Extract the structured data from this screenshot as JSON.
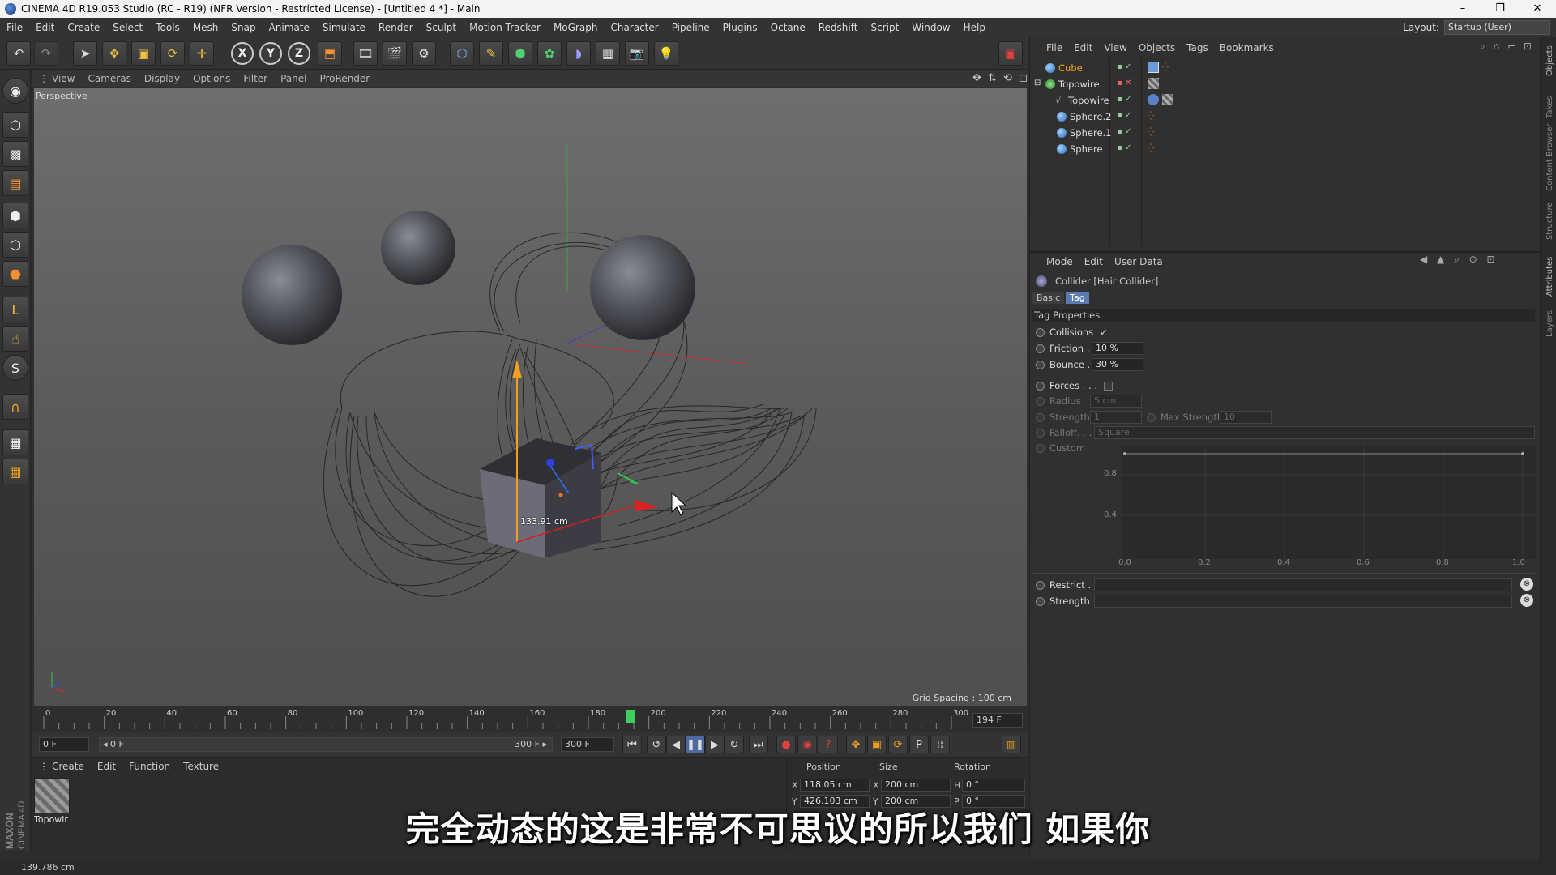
{
  "window": {
    "title": "CINEMA 4D R19.053 Studio (RC - R19) (NFR Version - Restricted License) - [Untitled 4 *] - Main",
    "controls": [
      "–",
      "❐",
      "✕"
    ]
  },
  "menubar": {
    "items": [
      "File",
      "Edit",
      "Create",
      "Select",
      "Tools",
      "Mesh",
      "Snap",
      "Animate",
      "Simulate",
      "Render",
      "Sculpt",
      "Motion Tracker",
      "MoGraph",
      "Character",
      "Pipeline",
      "Plugins",
      "Octane",
      "Redshift",
      "Script",
      "Window",
      "Help"
    ],
    "layout_label": "Layout:",
    "layout_value": "Startup (User)"
  },
  "toolbar": {
    "axis_x": "X",
    "axis_y": "Y",
    "axis_z": "Z"
  },
  "viewport": {
    "menu": [
      "View",
      "Cameras",
      "Display",
      "Options",
      "Filter",
      "Panel",
      "ProRender"
    ],
    "label": "Perspective",
    "grid_spacing": "Grid Spacing : 100 cm",
    "measure": "133.91 cm",
    "nav_icons": "✥ ⇅ ⟲ ◻"
  },
  "timeline": {
    "ticks": [
      "0",
      "20",
      "40",
      "60",
      "80",
      "100",
      "120",
      "140",
      "160",
      "180",
      "200",
      "220",
      "240",
      "260",
      "280",
      "300"
    ],
    "current_frame": "194 F",
    "current_frame_value": 194,
    "start_field": "0 F",
    "range_start": "◂ 0 F",
    "range_end": "300 F ▸",
    "end_field": "300 F"
  },
  "material_manager": {
    "menu": [
      "Create",
      "Edit",
      "Function",
      "Texture"
    ],
    "material_name": "Topowir"
  },
  "coordinates": {
    "headers": [
      "Position",
      "Size",
      "Rotation"
    ],
    "row1": {
      "pos_label": "X",
      "pos": "118.05 cm",
      "size_label": "X",
      "size": "200 cm",
      "rot_label": "H",
      "rot": "0 °"
    },
    "row2": {
      "pos_label": "Y",
      "pos": "426.103 cm",
      "size_label": "Y",
      "size": "200 cm",
      "rot_label": "P",
      "rot": "0 °"
    }
  },
  "statusbar": {
    "text": "139.786 cm"
  },
  "object_manager": {
    "menu": [
      "File",
      "Edit",
      "View",
      "Objects",
      "Tags",
      "Bookmarks"
    ],
    "objects": [
      {
        "name": "Cube",
        "selected": true
      },
      {
        "name": "Topowire",
        "selected": false
      },
      {
        "name": "Topowire",
        "selected": false
      },
      {
        "name": "Sphere.2",
        "selected": false
      },
      {
        "name": "Sphere.1",
        "selected": false
      },
      {
        "name": "Sphere",
        "selected": false
      }
    ]
  },
  "attribute_manager": {
    "menu": [
      "Mode",
      "Edit",
      "User Data"
    ],
    "title": "Collider [Hair Collider]",
    "tabs": [
      "Basic",
      "Tag"
    ],
    "section": "Tag Properties",
    "collisions_label": "Collisions",
    "friction_label": "Friction . .",
    "friction_value": "10 %",
    "bounce_label": "Bounce . .",
    "bounce_value": "30 %",
    "forces_label": "Forces . . .",
    "radius_label": "Radius",
    "radius_value": "5 cm",
    "strength_label": "Strength",
    "strength_value": "1",
    "max_strength_label": "Max Strength",
    "max_strength_value": "10",
    "falloff_label": "Falloff. . .",
    "falloff_value": "Square",
    "custom_label": "Custom",
    "graph_y": [
      "0.8",
      "0.4"
    ],
    "graph_x": [
      "0.0",
      "0.2",
      "0.4",
      "0.6",
      "0.8",
      "1.0"
    ],
    "restrict_label": "Restrict .",
    "strength2_label": "Strength"
  },
  "side_tabs": [
    "Objects",
    "Takes",
    "Content Browser",
    "Structure",
    "Attributes",
    "Layers"
  ],
  "logo": {
    "text": "MAXON CINEMA 4D"
  },
  "subtitle": "完全动态的这是非常不可思议的所以我们 如果你",
  "colors": {
    "accent_orange": "#f0a020",
    "selected_blue": "#7ab0ff",
    "timeline_marker": "#3fcf5f"
  }
}
